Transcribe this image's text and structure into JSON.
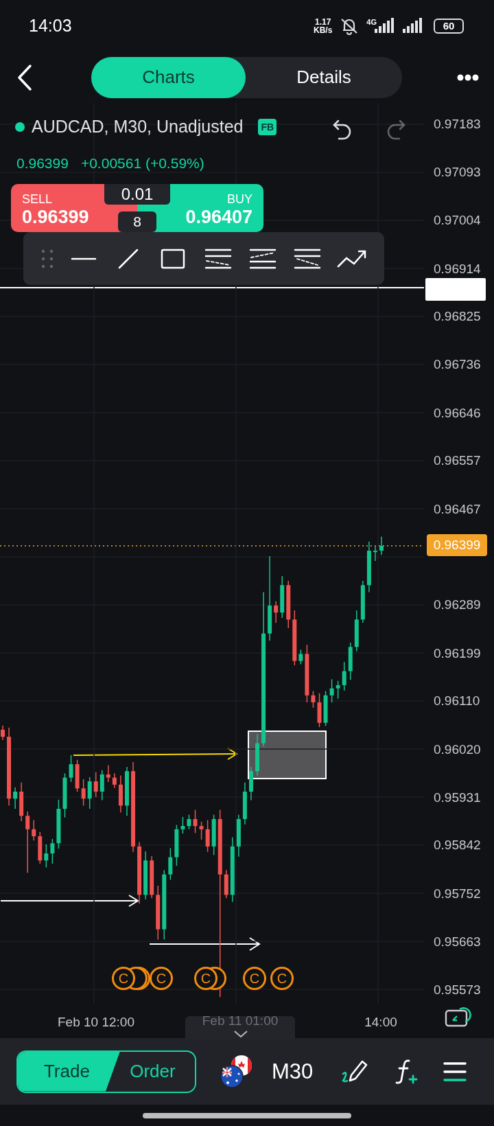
{
  "status_bar": {
    "time": "14:03",
    "speed_value": "1.17",
    "speed_unit": "KB/s",
    "network": "4G",
    "battery": "60"
  },
  "tabs": [
    {
      "label": "Charts",
      "selected": true
    },
    {
      "label": "Details",
      "selected": false
    }
  ],
  "symbol": {
    "title": "AUDCAD, M30, Unadjusted",
    "badge": "FB",
    "price": "0.96399",
    "change": "+0.00561 (+0.59%)",
    "undo_disabled": false,
    "redo_disabled": true
  },
  "quote": {
    "sell_label": "SELL",
    "sell_price": "0.96399",
    "buy_label": "BUY",
    "buy_price": "0.96407",
    "lot": "0.01",
    "spread": "8"
  },
  "price_axis": {
    "current_price": "0.96399"
  },
  "chart_data": {
    "type": "candlestick",
    "ylim": [
      0.95573,
      0.97183
    ],
    "grid": true,
    "yticks": [
      {
        "value": 0.97183,
        "label": "0.97183"
      },
      {
        "value": 0.97093,
        "label": "0.97093"
      },
      {
        "value": 0.97004,
        "label": "0.97004"
      },
      {
        "value": 0.96914,
        "label": "0.96914"
      },
      {
        "value": 0.96825,
        "label": "0.96825"
      },
      {
        "value": 0.96736,
        "label": "0.96736"
      },
      {
        "value": 0.96646,
        "label": "0.96646"
      },
      {
        "value": 0.96557,
        "label": "0.96557"
      },
      {
        "value": 0.96467,
        "label": "0.96467"
      },
      {
        "value": 0.96289,
        "label": "0.96289"
      },
      {
        "value": 0.96199,
        "label": "0.96199"
      },
      {
        "value": 0.9611,
        "label": "0.96110"
      },
      {
        "value": 0.9602,
        "label": "0.96020"
      },
      {
        "value": 0.95931,
        "label": "0.95931"
      },
      {
        "value": 0.95842,
        "label": "0.95842"
      },
      {
        "value": 0.95752,
        "label": "0.95752"
      },
      {
        "value": 0.95663,
        "label": "0.95663"
      },
      {
        "value": 0.95573,
        "label": "0.95573"
      }
    ],
    "categories": [
      null,
      null,
      null,
      null,
      null,
      null,
      null,
      null,
      null,
      null,
      null,
      null,
      null,
      null,
      null,
      null,
      null,
      null,
      null,
      null,
      null,
      null,
      null,
      null,
      null,
      null,
      null,
      null,
      null,
      null,
      null,
      null,
      null,
      null,
      null,
      null,
      null,
      null,
      null,
      null,
      null,
      null,
      null,
      null,
      null,
      null,
      null,
      null,
      null,
      null,
      null,
      null,
      null,
      null,
      null,
      null,
      null,
      null,
      null,
      null,
      null,
      null
    ],
    "ohlc": [
      [
        0.96057,
        0.96065,
        0.96038,
        0.96044
      ],
      [
        0.96044,
        0.96061,
        0.95916,
        0.95929
      ],
      [
        0.95929,
        0.9595,
        0.9591,
        0.95942
      ],
      [
        0.95942,
        0.95959,
        0.95887,
        0.95897
      ],
      [
        0.95897,
        0.95905,
        0.95791,
        0.95872
      ],
      [
        0.95872,
        0.95889,
        0.95851,
        0.95859
      ],
      [
        0.95859,
        0.95867,
        0.95808,
        0.95814
      ],
      [
        0.95814,
        0.95844,
        0.95801,
        0.95827
      ],
      [
        0.95827,
        0.95854,
        0.95808,
        0.95846
      ],
      [
        0.95846,
        0.95927,
        0.95836,
        0.9591
      ],
      [
        0.9591,
        0.95976,
        0.95894,
        0.95968
      ],
      [
        0.95968,
        0.9601,
        0.9596,
        0.95993
      ],
      [
        0.95993,
        0.96001,
        0.95942,
        0.95948
      ],
      [
        0.95948,
        0.95965,
        0.95916,
        0.95929
      ],
      [
        0.95929,
        0.95969,
        0.9591,
        0.95961
      ],
      [
        0.95961,
        0.95978,
        0.95932,
        0.95942
      ],
      [
        0.95942,
        0.95982,
        0.95926,
        0.95974
      ],
      [
        0.95974,
        0.95991,
        0.9596,
        0.95968
      ],
      [
        0.95968,
        0.95976,
        0.95949,
        0.95955
      ],
      [
        0.95955,
        0.95972,
        0.95903,
        0.95916
      ],
      [
        0.95916,
        0.95988,
        0.95897,
        0.9598
      ],
      [
        0.9598,
        0.95997,
        0.9583,
        0.9584
      ],
      [
        0.9584,
        0.95848,
        0.95734,
        0.9575
      ],
      [
        0.9575,
        0.95831,
        0.95742,
        0.95814
      ],
      [
        0.95814,
        0.95822,
        0.95744,
        0.9575
      ],
      [
        0.9575,
        0.95767,
        0.95667,
        0.95686
      ],
      [
        0.95686,
        0.95796,
        0.95667,
        0.95788
      ],
      [
        0.95788,
        0.95837,
        0.95778,
        0.9582
      ],
      [
        0.9582,
        0.9588,
        0.95804,
        0.95872
      ],
      [
        0.95872,
        0.95895,
        0.95864,
        0.95878
      ],
      [
        0.95878,
        0.95899,
        0.95872,
        0.95891
      ],
      [
        0.95891,
        0.95908,
        0.95865,
        0.95878
      ],
      [
        0.95878,
        0.95886,
        0.95853,
        0.95872
      ],
      [
        0.95872,
        0.95889,
        0.9583,
        0.9584
      ],
      [
        0.9584,
        0.95899,
        0.95824,
        0.95891
      ],
      [
        0.95891,
        0.95908,
        0.9556,
        0.95788
      ],
      [
        0.95788,
        0.95796,
        0.95744,
        0.9575
      ],
      [
        0.9575,
        0.95857,
        0.95737,
        0.9584
      ],
      [
        0.9584,
        0.95899,
        0.95821,
        0.95891
      ],
      [
        0.95891,
        0.95959,
        0.95881,
        0.95942
      ],
      [
        0.95942,
        0.95988,
        0.95926,
        0.9598
      ],
      [
        0.9598,
        0.96049,
        0.95972,
        0.96032
      ],
      [
        0.96032,
        0.96313,
        0.96026,
        0.96236
      ],
      [
        0.96236,
        0.9638,
        0.96223,
        0.96288
      ],
      [
        0.96288,
        0.96296,
        0.96256,
        0.96275
      ],
      [
        0.96275,
        0.96343,
        0.96265,
        0.96326
      ],
      [
        0.96326,
        0.96334,
        0.96246,
        0.96262
      ],
      [
        0.96262,
        0.96279,
        0.96177,
        0.96185
      ],
      [
        0.96185,
        0.96206,
        0.96179,
        0.96198
      ],
      [
        0.96198,
        0.96215,
        0.96108,
        0.96121
      ],
      [
        0.96121,
        0.96129,
        0.96098,
        0.96108
      ],
      [
        0.96108,
        0.96125,
        0.96062,
        0.9607
      ],
      [
        0.9607,
        0.96129,
        0.96064,
        0.96121
      ],
      [
        0.96121,
        0.96151,
        0.96108,
        0.96134
      ],
      [
        0.96134,
        0.96148,
        0.96115,
        0.9614
      ],
      [
        0.9614,
        0.96183,
        0.9613,
        0.96166
      ],
      [
        0.96166,
        0.96219,
        0.9615,
        0.96211
      ],
      [
        0.96211,
        0.96279,
        0.96203,
        0.96262
      ],
      [
        0.96262,
        0.96334,
        0.96256,
        0.96326
      ],
      [
        0.96326,
        0.96407,
        0.96313,
        0.9639
      ],
      [
        0.9639,
        0.96398,
        0.96371,
        0.9639
      ],
      [
        0.9639,
        0.96416,
        0.96382,
        0.96399
      ]
    ]
  },
  "time_axis": [
    {
      "label": "Feb 10 12:00",
      "kind": "tick"
    },
    {
      "label": "Feb 11 01:00",
      "kind": "cursor"
    },
    {
      "label": "14:00",
      "kind": "tick"
    }
  ],
  "event_markers": [
    {
      "label": "C"
    },
    {
      "label": "C"
    },
    {
      "label": "C"
    },
    {
      "label": "C"
    },
    {
      "label": "C"
    }
  ],
  "bottom_bar": {
    "modes": [
      {
        "label": "Trade",
        "selected": true
      },
      {
        "label": "Order",
        "selected": false
      }
    ],
    "timeframe": "M30"
  }
}
